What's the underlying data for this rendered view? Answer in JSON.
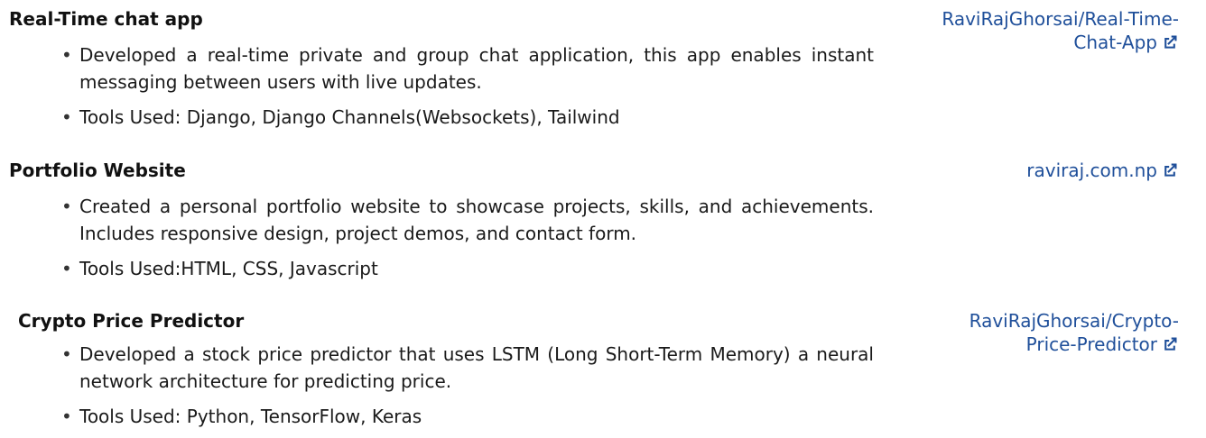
{
  "projects": [
    {
      "title": "Real-Time chat app",
      "bullets": [
        "Developed a real-time private and group chat application, this app enables instant messaging between users with live updates.",
        "Tools Used: Django, Django Channels(Websockets), Tailwind"
      ],
      "link_lines": [
        "RaviRajGhorsai/Real-Time-",
        "Chat-App"
      ]
    },
    {
      "title": "Portfolio Website",
      "bullets": [
        "Created a personal portfolio website to showcase projects, skills, and achievements. Includes responsive design, project demos, and contact form.",
        "Tools Used:HTML, CSS, Javascript"
      ],
      "link_lines": [
        "raviraj.com.np"
      ]
    },
    {
      "title": "Crypto Price Predictor",
      "bullets": [
        "Developed a stock price predictor that uses LSTM (Long Short-Term Memory) a neural network architecture for predicting price.",
        "Tools Used: Python, TensorFlow, Keras"
      ],
      "link_lines": [
        "RaviRajGhorsai/Crypto-",
        "Price-Predictor"
      ]
    }
  ],
  "icons": {
    "external_link": "external-link-icon"
  },
  "colors": {
    "link": "#1f4f9a",
    "text": "#1a1a1a"
  }
}
